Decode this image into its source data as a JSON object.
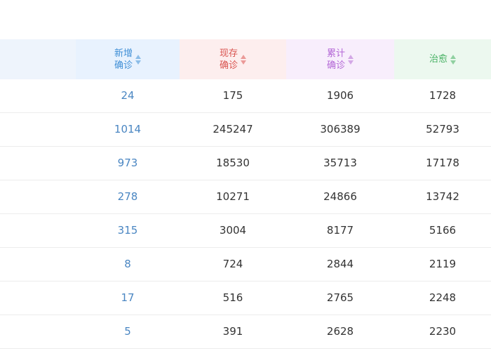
{
  "header": {
    "new_confirmed": [
      "新增",
      "确诊"
    ],
    "existing_confirmed": [
      "现存",
      "确诊"
    ],
    "total_confirmed": [
      "累计",
      "确诊"
    ],
    "cured": "治愈"
  },
  "rows": [
    {
      "new": "24",
      "existing": "175",
      "total": "1906",
      "cured": "1728"
    },
    {
      "new": "1014",
      "existing": "245247",
      "total": "306389",
      "cured": "52793"
    },
    {
      "new": "973",
      "existing": "18530",
      "total": "35713",
      "cured": "17178"
    },
    {
      "new": "278",
      "existing": "10271",
      "total": "24866",
      "cured": "13742"
    },
    {
      "new": "315",
      "existing": "3004",
      "total": "8177",
      "cured": "5166"
    },
    {
      "new": "8",
      "existing": "724",
      "total": "2844",
      "cured": "2119"
    },
    {
      "new": "17",
      "existing": "516",
      "total": "2765",
      "cured": "2248"
    },
    {
      "new": "5",
      "existing": "391",
      "total": "2628",
      "cured": "2230"
    }
  ]
}
